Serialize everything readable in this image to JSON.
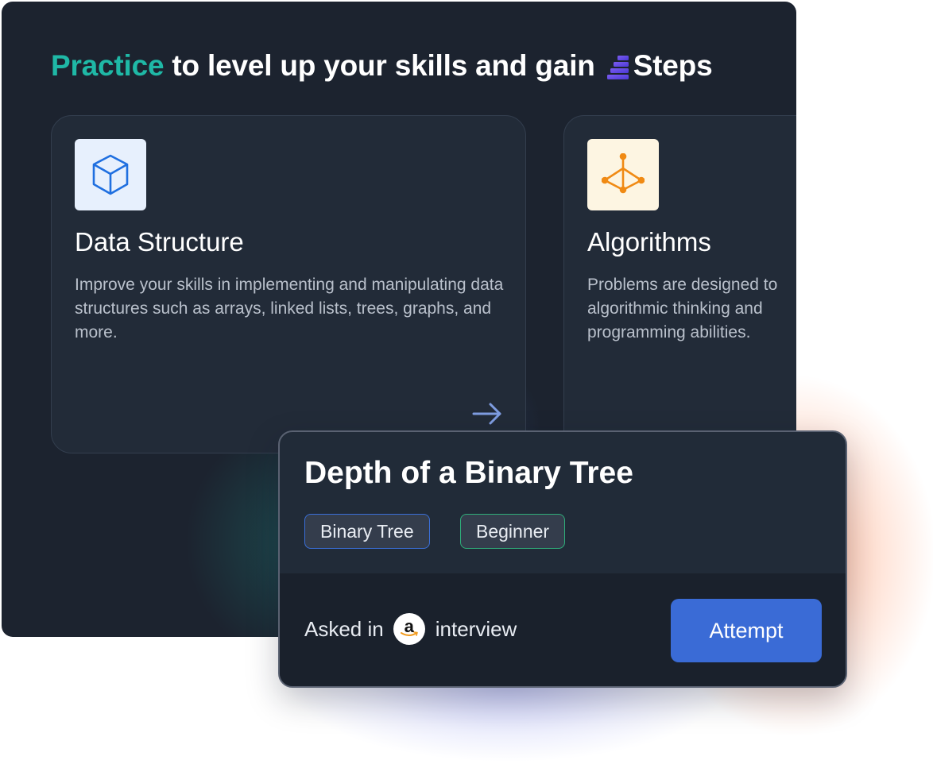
{
  "headline": {
    "accent": "Practice",
    "text": "to level up your skills and gain",
    "brand": "Steps"
  },
  "cards": [
    {
      "title": "Data Structure",
      "description": "Improve your skills in implementing and manipulating data structures such as arrays, linked lists, trees, graphs, and more.",
      "icon": "cube-icon"
    },
    {
      "title": "Algorithms",
      "description_lines": [
        "Problems are designed to",
        "algorithmic thinking and",
        "programming abilities."
      ],
      "icon": "binary-tree-icon"
    }
  ],
  "problem": {
    "title": "Depth of a Binary Tree",
    "tags": [
      "Binary Tree",
      "Beginner"
    ],
    "asked_prefix": "Asked in",
    "company_icon": "amazon-logo",
    "asked_suffix": "interview",
    "attempt_label": "Attempt"
  },
  "colors": {
    "accent": "#1fb8a6",
    "panel": "#1c232f",
    "button": "#3a6bd6",
    "tag_topic_border": "#3a6fd8",
    "tag_level_border": "#2fae7a"
  }
}
